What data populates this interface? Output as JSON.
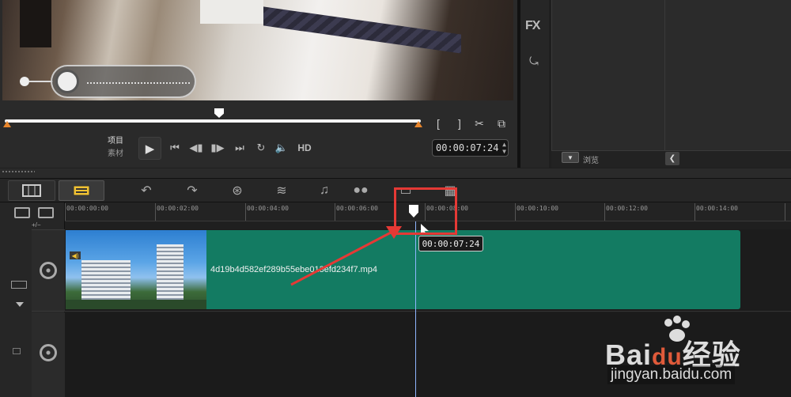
{
  "preview": {
    "mode_project": "项目",
    "mode_clip": "素材",
    "hd_label": "HD",
    "timecode": "00:00:07:24",
    "icons": [
      "play-icon",
      "go-start-icon",
      "prev-frame-icon",
      "next-frame-icon",
      "go-end-icon",
      "repeat-icon",
      "volume-icon",
      "mark-in-icon",
      "mark-out-icon",
      "cut-icon",
      "copy-icon"
    ]
  },
  "sidepanel": {
    "fx_label": "FX",
    "browse_label": "浏览"
  },
  "ruler": {
    "ticks": [
      "00:00:00:00",
      "00:00:02:00",
      "00:00:04:00",
      "00:00:06:00",
      "00:00:08:00",
      "00:00:10:00",
      "00:00:12:00",
      "00:00:14:00"
    ],
    "sub_label": "+/−"
  },
  "clip": {
    "name": "4d19b4d582ef289b55ebe013efd234f7.mp4"
  },
  "playhead_tooltip": "00:00:07:24",
  "watermark": {
    "brand": "Bai",
    "brand_du": "du",
    "brand_cn": "经验",
    "url": "jingyan.baidu.com"
  },
  "colors": {
    "clip": "#137b62",
    "annotation": "#e53935",
    "trim": "#e8852b",
    "playhead": "#8fb6ff"
  }
}
